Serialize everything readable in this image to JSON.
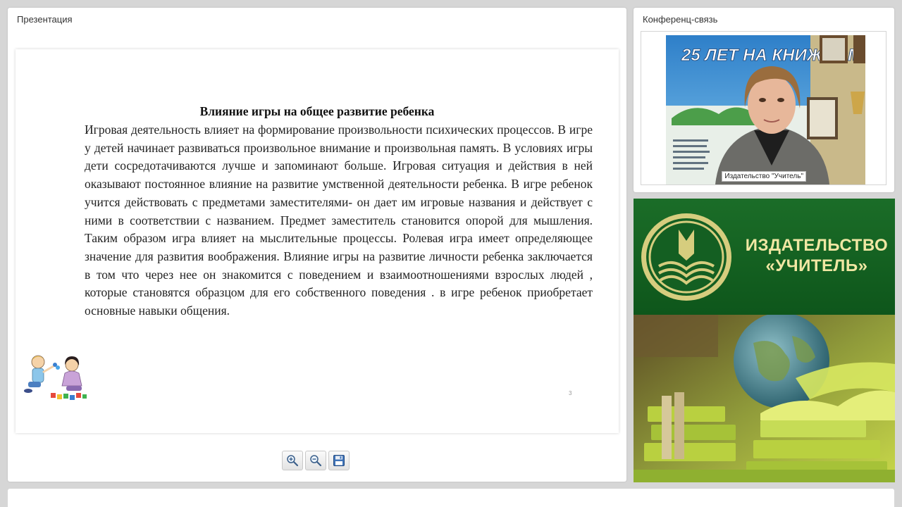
{
  "presentation": {
    "title": "Презентация",
    "slide": {
      "heading": "Влияние игры на общее развитие ребенка",
      "body": "Игровая деятельность влияет на формирование произвольности психических процессов. В игре у детей начинает развиваться произвольное внимание и произвольная память. В условиях игры дети сосредотачиваются лучше и запоминают больше. Игровая ситуация и действия в ней оказывают постоянное влияние на развитие умственной деятельности ребенка. В игре ребенок учится действовать с предметами заместителями- он дает им игровые названия и действует с ними в соответствии с названием. Предмет заместитель становится опорой для мышления. Таким образом игра влияет на мыслительные процессы. Ролевая игра имеет определяющее значение для развития воображения. Влияние игры на развитие личности ребенка заключается в том что через нее он знакомится с поведением и взаимоотношениями взрослых людей , которые становятся образцом для его собственного поведения . в игре ребенок приобретает основные навыки общения.",
      "page_number": "3"
    },
    "toolbar": {
      "zoom_in_icon": "zoom-in-icon",
      "zoom_out_icon": "zoom-out-icon",
      "save_icon": "floppy-disk-icon"
    }
  },
  "conference": {
    "title": "Конференц-связь",
    "video_label": "Издательство \"Учитель\"",
    "banner_text": "25 ЛЕТ НА КНИЖНОМ"
  },
  "promo": {
    "name_line1": "ИЗДАТЕЛЬСТВО",
    "name_line2": "«УЧИТЕЛЬ»"
  },
  "colors": {
    "promo_green": "#0f5a1d",
    "promo_text": "#f0e7a3"
  }
}
